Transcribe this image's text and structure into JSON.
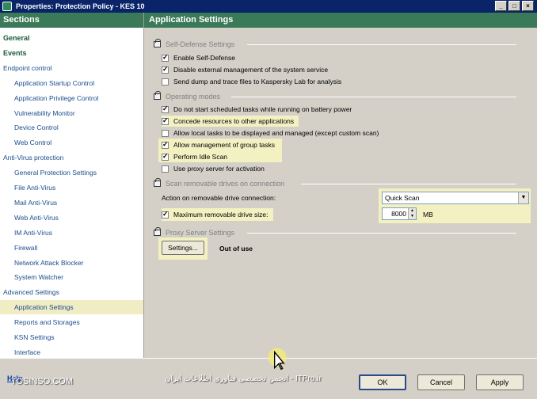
{
  "window": {
    "title": "Properties: Protection Policy - KES 10",
    "controls": [
      "_",
      "□",
      "×"
    ]
  },
  "sections": {
    "header": "Sections",
    "items": [
      {
        "label": "General",
        "level": 0,
        "bold": true
      },
      {
        "label": "Events",
        "level": 0,
        "bold": true
      },
      {
        "label": "Endpoint control",
        "level": 0
      },
      {
        "label": "Application Startup Control",
        "level": 1
      },
      {
        "label": "Application Privilege Control",
        "level": 1
      },
      {
        "label": "Vulnerability Monitor",
        "level": 1
      },
      {
        "label": "Device Control",
        "level": 1
      },
      {
        "label": "Web Control",
        "level": 1
      },
      {
        "label": "Anti-Virus protection",
        "level": 0
      },
      {
        "label": "General Protection Settings",
        "level": 1
      },
      {
        "label": "File Anti-Virus",
        "level": 1
      },
      {
        "label": "Mail Anti-Virus",
        "level": 1
      },
      {
        "label": "Web Anti-Virus",
        "level": 1
      },
      {
        "label": "IM Anti-Virus",
        "level": 1
      },
      {
        "label": "Firewall",
        "level": 1
      },
      {
        "label": "Network Attack Blocker",
        "level": 1
      },
      {
        "label": "System Watcher",
        "level": 1
      },
      {
        "label": "Advanced Settings",
        "level": 0
      },
      {
        "label": "Application Settings",
        "level": 1,
        "selected": true
      },
      {
        "label": "Reports and Storages",
        "level": 1
      },
      {
        "label": "KSN Settings",
        "level": 1
      },
      {
        "label": "Interface",
        "level": 1
      }
    ]
  },
  "main": {
    "header": "Application Settings",
    "self_defense": {
      "title": "Self-Defense Settings",
      "options": [
        {
          "label": "Enable Self-Defense",
          "checked": true
        },
        {
          "label": "Disable external management of the system service",
          "checked": true
        },
        {
          "label": "Send dump and trace files to Kaspersky Lab for analysis",
          "checked": false
        }
      ]
    },
    "operating_modes": {
      "title": "Operating modes",
      "options": [
        {
          "label": "Do not start scheduled tasks while running on battery power",
          "checked": true
        },
        {
          "label": "Concede resources to other applications",
          "checked": true
        },
        {
          "label": "Allow local tasks to be displayed and managed (except custom scan)",
          "checked": false
        },
        {
          "label": "Allow management of group tasks",
          "checked": true
        },
        {
          "label": "Perform Idle Scan",
          "checked": true
        },
        {
          "label": "Use proxy server for activation",
          "checked": false
        }
      ]
    },
    "removable": {
      "title": "Scan removable drives on connection",
      "action_label": "Action on removable drive connection:",
      "action_value": "Quick Scan",
      "max_size_label": "Maximum removable drive size:",
      "max_size_checked": true,
      "max_size_value": "8000",
      "max_size_unit": "MB"
    },
    "proxy": {
      "title": "Proxy Server Settings",
      "settings_button": "Settings...",
      "status": "Out of use"
    }
  },
  "footer": {
    "help": "Help",
    "watermark_left": "TOSINSO.COM",
    "watermark_right": "انجمن تخصصی فناوری اطلاعات ایران - ITPro.ir",
    "ok": "OK",
    "cancel": "Cancel",
    "apply": "Apply"
  }
}
